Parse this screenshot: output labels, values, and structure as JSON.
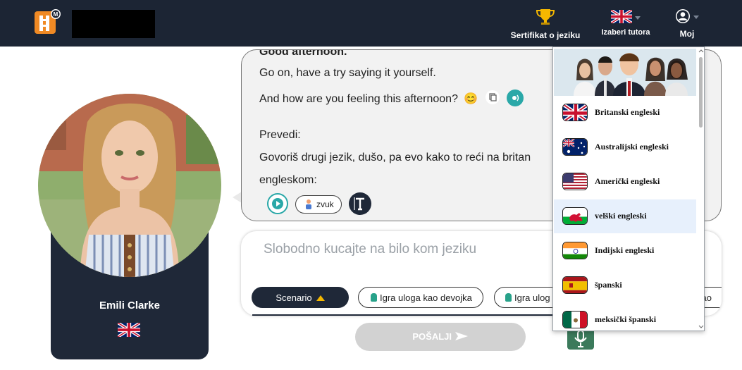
{
  "header": {
    "certificate_label": "Sertifikat o jeziku",
    "tutor_label": "Izaberi tutora",
    "account_label": "Moj"
  },
  "tutor": {
    "name": "Emili Clarke",
    "accent": "British"
  },
  "chat": {
    "header_partial": "Good afternoon.",
    "line1": "Go on, have a try saying it yourself.",
    "line2": "And how are you feeling this afternoon?",
    "emoji": "😊",
    "line3": "Prevedi:",
    "line4": "Govoriš drugi jezik, dušo, pa evo kako to reći na britan",
    "line5": "engleskom:",
    "sound_label": "zvuk"
  },
  "input": {
    "placeholder": "Slobodno kucajte na bilo kom jeziku",
    "scenario_label": "Scenario",
    "chip1": "Igra uloga kao devojka",
    "chip2": "Igra ulog",
    "chip3_partial": "kao",
    "send_label": "POŠALJI"
  },
  "dropdown": {
    "items": [
      {
        "label": "Britanski engleski",
        "flag": "uk"
      },
      {
        "label": "Australijski engleski",
        "flag": "au"
      },
      {
        "label": "Američki engleski",
        "flag": "us"
      },
      {
        "label": "velški engleski",
        "flag": "wales",
        "selected": true
      },
      {
        "label": "Indijski engleski",
        "flag": "in"
      },
      {
        "label": "španski",
        "flag": "es"
      },
      {
        "label": "meksički španski",
        "flag": "mx"
      }
    ]
  },
  "colors": {
    "navy": "#1c2534",
    "teal": "#2aa8a8",
    "gold": "#f5b800"
  }
}
